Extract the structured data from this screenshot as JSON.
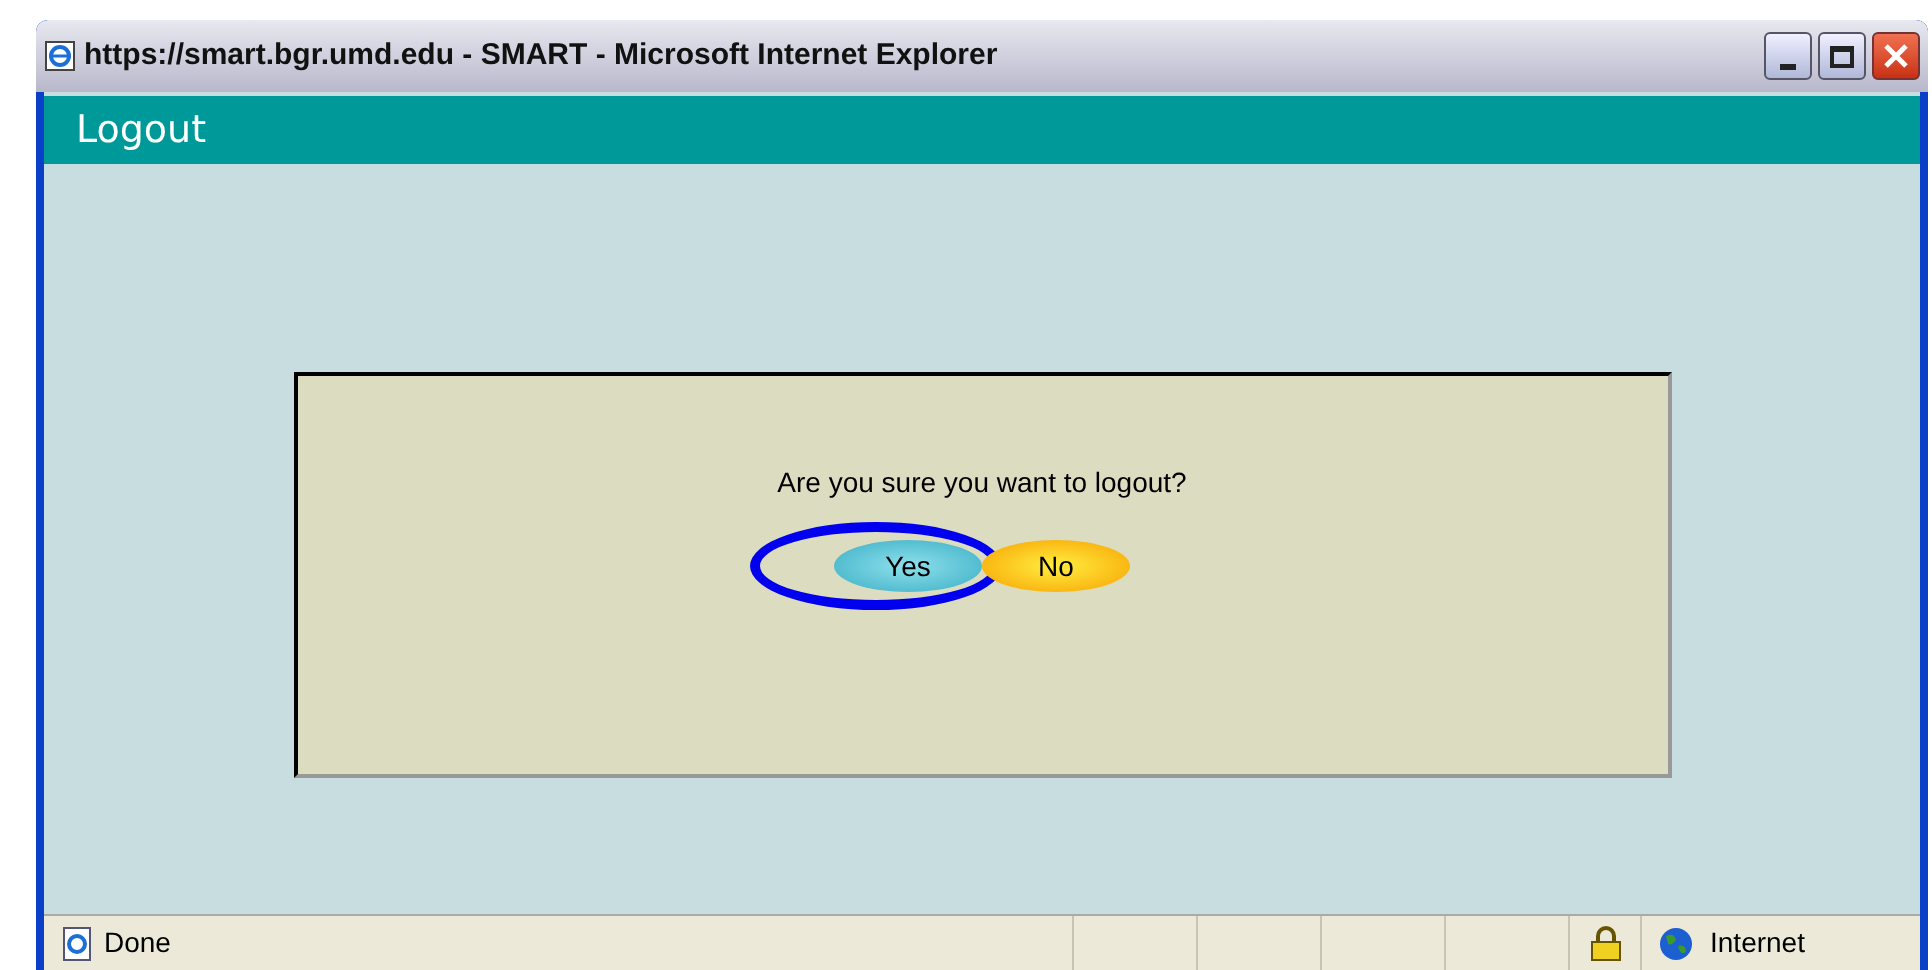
{
  "window": {
    "title": "https://smart.bgr.umd.edu - SMART - Microsoft Internet Explorer"
  },
  "page_header": {
    "title": "Logout"
  },
  "dialog": {
    "message": "Are you sure you want to logout?",
    "buttons": [
      {
        "label": "Yes",
        "kind": "confirm",
        "highlighted": true
      },
      {
        "label": "No",
        "kind": "cancel",
        "highlighted": false
      }
    ]
  },
  "status_bar": {
    "text": "Done",
    "zone": "Internet",
    "secure": true
  }
}
